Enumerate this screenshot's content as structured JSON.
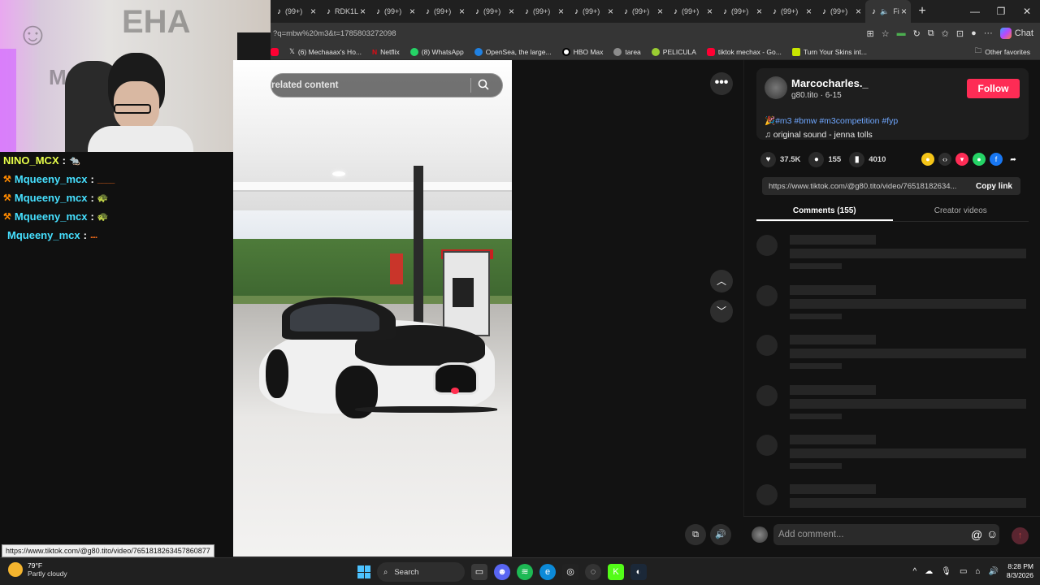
{
  "browser": {
    "tabs": [
      {
        "icon": "tiktok-icon",
        "label": "(99+)"
      },
      {
        "icon": "tiktok-icon",
        "label": "RDK1L"
      },
      {
        "icon": "tiktok-icon",
        "label": "(99+)"
      },
      {
        "icon": "tiktok-icon",
        "label": "(99+)"
      },
      {
        "icon": "tiktok-icon",
        "label": "(99+)"
      },
      {
        "icon": "tiktok-icon",
        "label": "(99+)"
      },
      {
        "icon": "tiktok-icon",
        "label": "(99+)"
      },
      {
        "icon": "tiktok-icon",
        "label": "(99+)"
      },
      {
        "icon": "tiktok-icon",
        "label": "(99+)"
      },
      {
        "icon": "tiktok-icon",
        "label": "(99+)"
      },
      {
        "icon": "tiktok-icon",
        "label": "(99+)"
      },
      {
        "icon": "tiktok-icon",
        "label": "(99+)"
      }
    ],
    "active_tab_label": "Fi",
    "new_tab": "+",
    "address_url": "?q=mbw%20m3&t=1785803272098",
    "chat_label": "Chat",
    "bookmarks": [
      {
        "label": "(6) Mechaaax's Ho...",
        "color": "#000000"
      },
      {
        "label": "Netflix",
        "color": "#e50914"
      },
      {
        "label": "(8) WhatsApp",
        "color": "#25d366"
      },
      {
        "label": "OpenSea, the large...",
        "color": "#2081e2"
      },
      {
        "label": "HBO Max",
        "color": "#ffffff"
      },
      {
        "label": "tarea",
        "color": "#8c8c8c"
      },
      {
        "label": "PELICULA",
        "color": "#9acd32"
      },
      {
        "label": "tiktok mechax - Go...",
        "color": "#ff0033"
      },
      {
        "label": "Turn Your Skins int...",
        "color": "#c8e600"
      }
    ],
    "other_favorites": "Other favorites"
  },
  "stream_chat": {
    "messages": [
      {
        "user": "NINO_MCX",
        "text": "",
        "emote": "🐀",
        "user_color": "#e8ff4a",
        "badge": ""
      },
      {
        "user": "Mqueeny_mcx",
        "text": "____",
        "emote": "",
        "user_color": "#46e0ff",
        "badge": "⚒"
      },
      {
        "user": "Mqueeny_mcx",
        "text": "",
        "emote": "🐢",
        "user_color": "#46e0ff",
        "badge": "⚒"
      },
      {
        "user": "Mqueeny_mcx",
        "text": "",
        "emote": "🐢",
        "user_color": "#46e0ff",
        "badge": "⚒"
      },
      {
        "user": "Mqueeny_mcx",
        "text": "....",
        "emote": "",
        "user_color": "#46e0ff",
        "badge": ""
      }
    ]
  },
  "status_url": "https://www.tiktok.com/@g80.tito/video/7651818263457860877",
  "player": {
    "search_placeholder": "related content",
    "more_icon": "•••",
    "up_icon": "chevron-up-icon",
    "down_icon": "chevron-down-icon"
  },
  "post": {
    "display_name": "Marcocharles._",
    "subline": "g80.tito · 6-15",
    "follow_label": "Follow",
    "hashtags": "#m3 #bmw #m3competition #fyp",
    "sound": "original sound - jenna tolls",
    "likes": "37.5K",
    "comments": "155",
    "saves": "4010",
    "share_url": "https://www.tiktok.com/@g80.tito/video/76518182634...",
    "copy_label": "Copy link",
    "tab_comments": "Comments (155)",
    "tab_creator": "Creator videos",
    "comment_placeholder": "Add comment..."
  },
  "taskbar": {
    "temp": "79°F",
    "weather": "Partly cloudy",
    "search_label": "Search",
    "time": "8:28 PM",
    "date": "8/3/2026"
  },
  "colors": {
    "follow": "#fe2c55",
    "hashtag": "#6fa7ff",
    "chat_user": "#46e0ff"
  }
}
